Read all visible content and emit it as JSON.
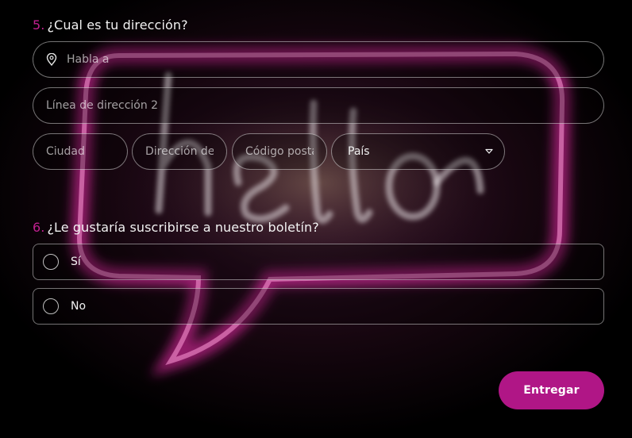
{
  "questions": {
    "address": {
      "number": "5.",
      "title": "¿Cual es tu dirección?",
      "street_placeholder": "Habla a",
      "address2_placeholder": "Línea de dirección 2",
      "city_placeholder": "Ciudad",
      "region_placeholder": "Dirección del",
      "zip_placeholder": "Código posta",
      "country_value": "País"
    },
    "newsletter": {
      "number": "6.",
      "title": "¿Le gustaría suscribirse a nuestro boletín?",
      "options": [
        {
          "label": "Sí",
          "selected": false
        },
        {
          "label": "No",
          "selected": false
        }
      ]
    }
  },
  "submit": {
    "label": "Entregar"
  },
  "colors": {
    "accent": "#c0208f",
    "button": "#b01686",
    "neon_pink": "#ff2fb8"
  },
  "background": {
    "lettering": "hello"
  },
  "icons": {
    "street": "map-pin-icon",
    "country": "chevron-down-icon"
  }
}
